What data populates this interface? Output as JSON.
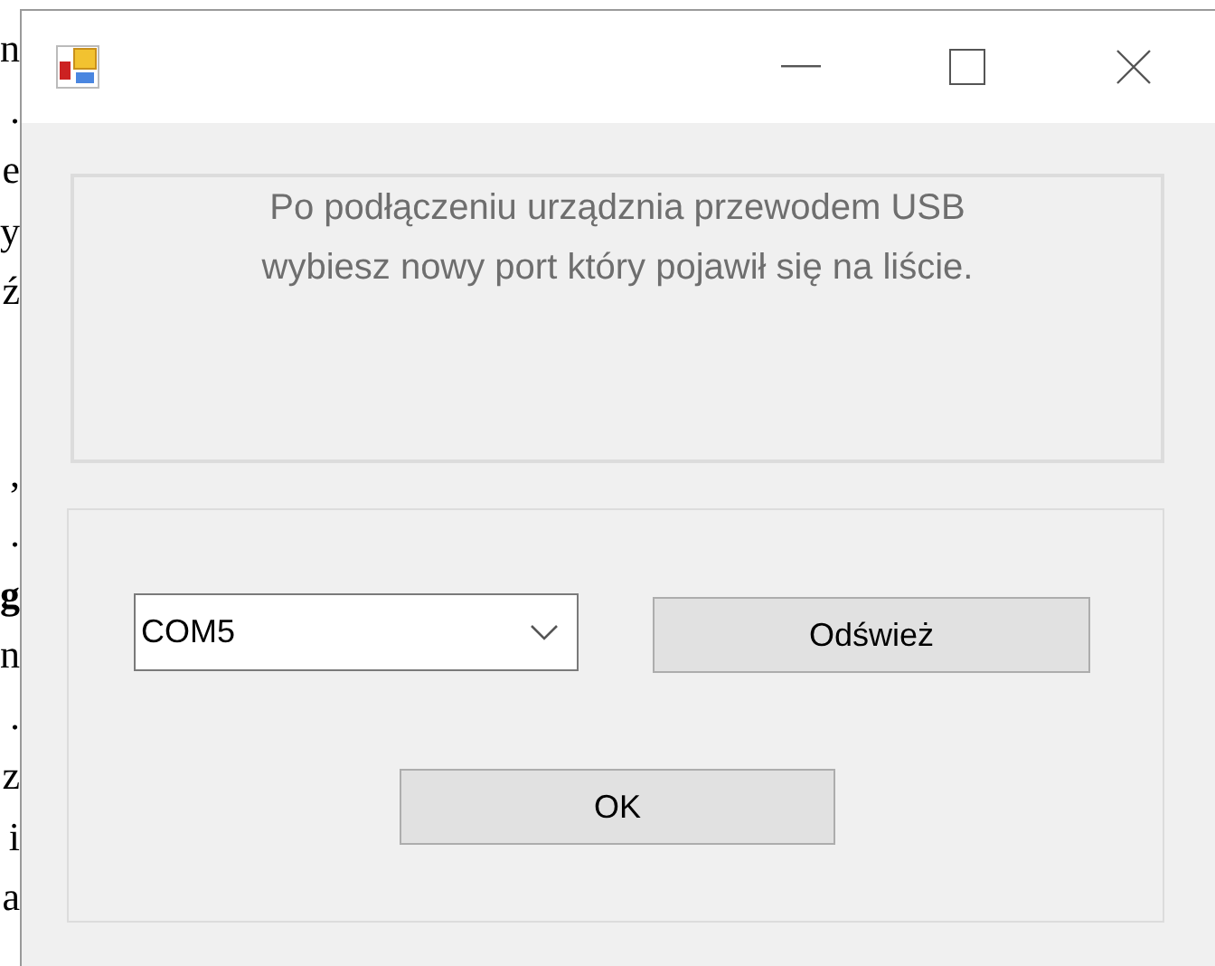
{
  "background_text": {
    "upper_lines": [
      {
        "text": "n",
        "bold": false
      },
      {
        "text": ".",
        "bold": false
      },
      {
        "text": "e",
        "bold": false
      },
      {
        "text": "y",
        "bold": false
      },
      {
        "text": "ź",
        "bold": false
      }
    ],
    "lower_lines": [
      {
        "text": ",",
        "bold": false
      },
      {
        "text": ".",
        "bold": false
      },
      {
        "text": "g",
        "bold": true
      },
      {
        "text": "n",
        "bold": false
      },
      {
        "text": ".",
        "bold": false
      },
      {
        "text": "z",
        "bold": false
      },
      {
        "text": "i",
        "bold": false
      },
      {
        "text": "a",
        "bold": false
      }
    ]
  },
  "window": {
    "controls": [
      {
        "kind": "minimize"
      },
      {
        "kind": "maximize"
      },
      {
        "kind": "close"
      }
    ]
  },
  "info_group": {
    "message": "Po podłączeniu urządznia przewodem USB wybiesz nowy port który pojawił się na liście."
  },
  "port_group": {
    "port_combo": {
      "value": "COM5"
    },
    "refresh_button": "Odśwież",
    "ok_button": "OK"
  }
}
